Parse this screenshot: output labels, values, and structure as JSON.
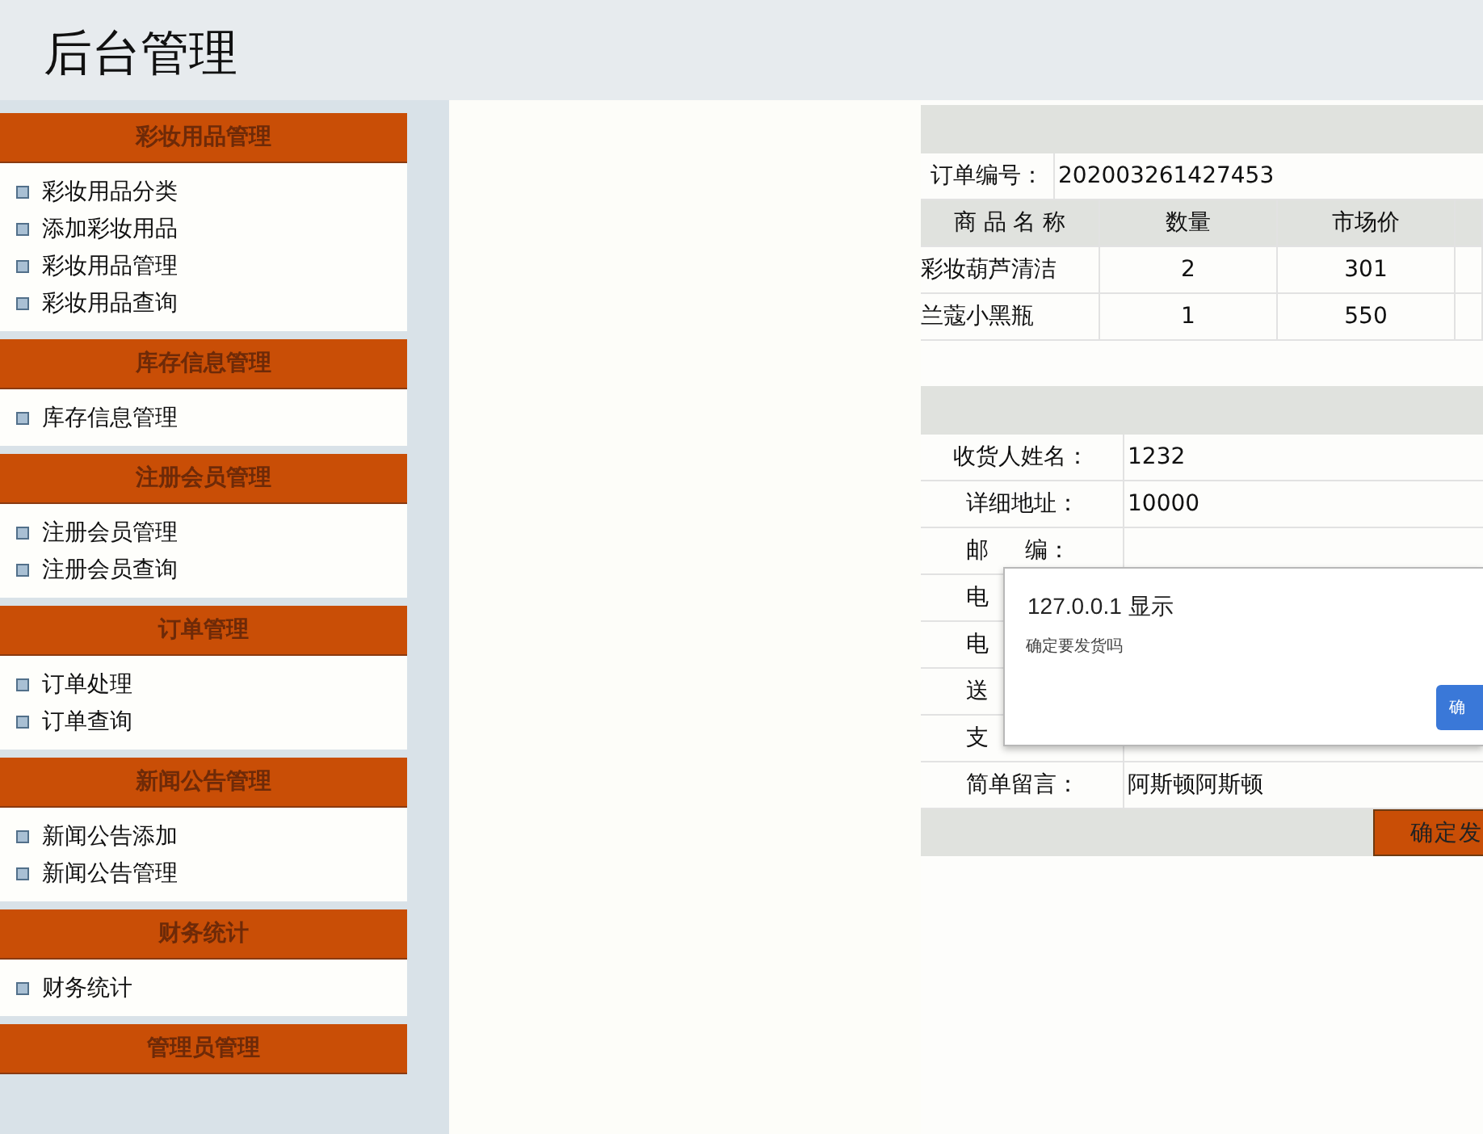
{
  "header": {
    "title": "后台管理"
  },
  "sidebar": {
    "groups": [
      {
        "title": "彩妆用品管理",
        "items": [
          "彩妆用品分类",
          "添加彩妆用品",
          "彩妆用品管理",
          "彩妆用品查询"
        ]
      },
      {
        "title": "库存信息管理",
        "items": [
          "库存信息管理"
        ]
      },
      {
        "title": "注册会员管理",
        "items": [
          "注册会员管理",
          "注册会员查询"
        ]
      },
      {
        "title": "订单管理",
        "items": [
          "订单处理",
          "订单查询"
        ]
      },
      {
        "title": "新闻公告管理",
        "items": [
          "新闻公告添加",
          "新闻公告管理"
        ]
      },
      {
        "title": "财务统计",
        "items": [
          "财务统计"
        ]
      },
      {
        "title": "管理员管理"
      }
    ]
  },
  "order": {
    "number_label": "订单编号：",
    "number": "202003261427453",
    "columns": [
      "商 品 名 称",
      "数量",
      "市场价"
    ],
    "rows": [
      [
        "彩妆葫芦清洁",
        "2",
        "301"
      ],
      [
        "兰蔻小黑瓶",
        "1",
        "550"
      ]
    ]
  },
  "shipping": {
    "fields": [
      {
        "label": "收货人姓名：",
        "value": "1232"
      },
      {
        "label": "详细地址：",
        "value": "10000"
      },
      {
        "label": "邮     编："
      },
      {
        "label": "电"
      },
      {
        "label": "电"
      },
      {
        "label": "送"
      },
      {
        "label": "支"
      },
      {
        "label": "简单留言：",
        "value": "阿斯顿阿斯顿"
      }
    ],
    "button": "确定发"
  },
  "dialog": {
    "title": "127.0.0.1 显示",
    "message": "确定要发货吗",
    "button": "确"
  }
}
